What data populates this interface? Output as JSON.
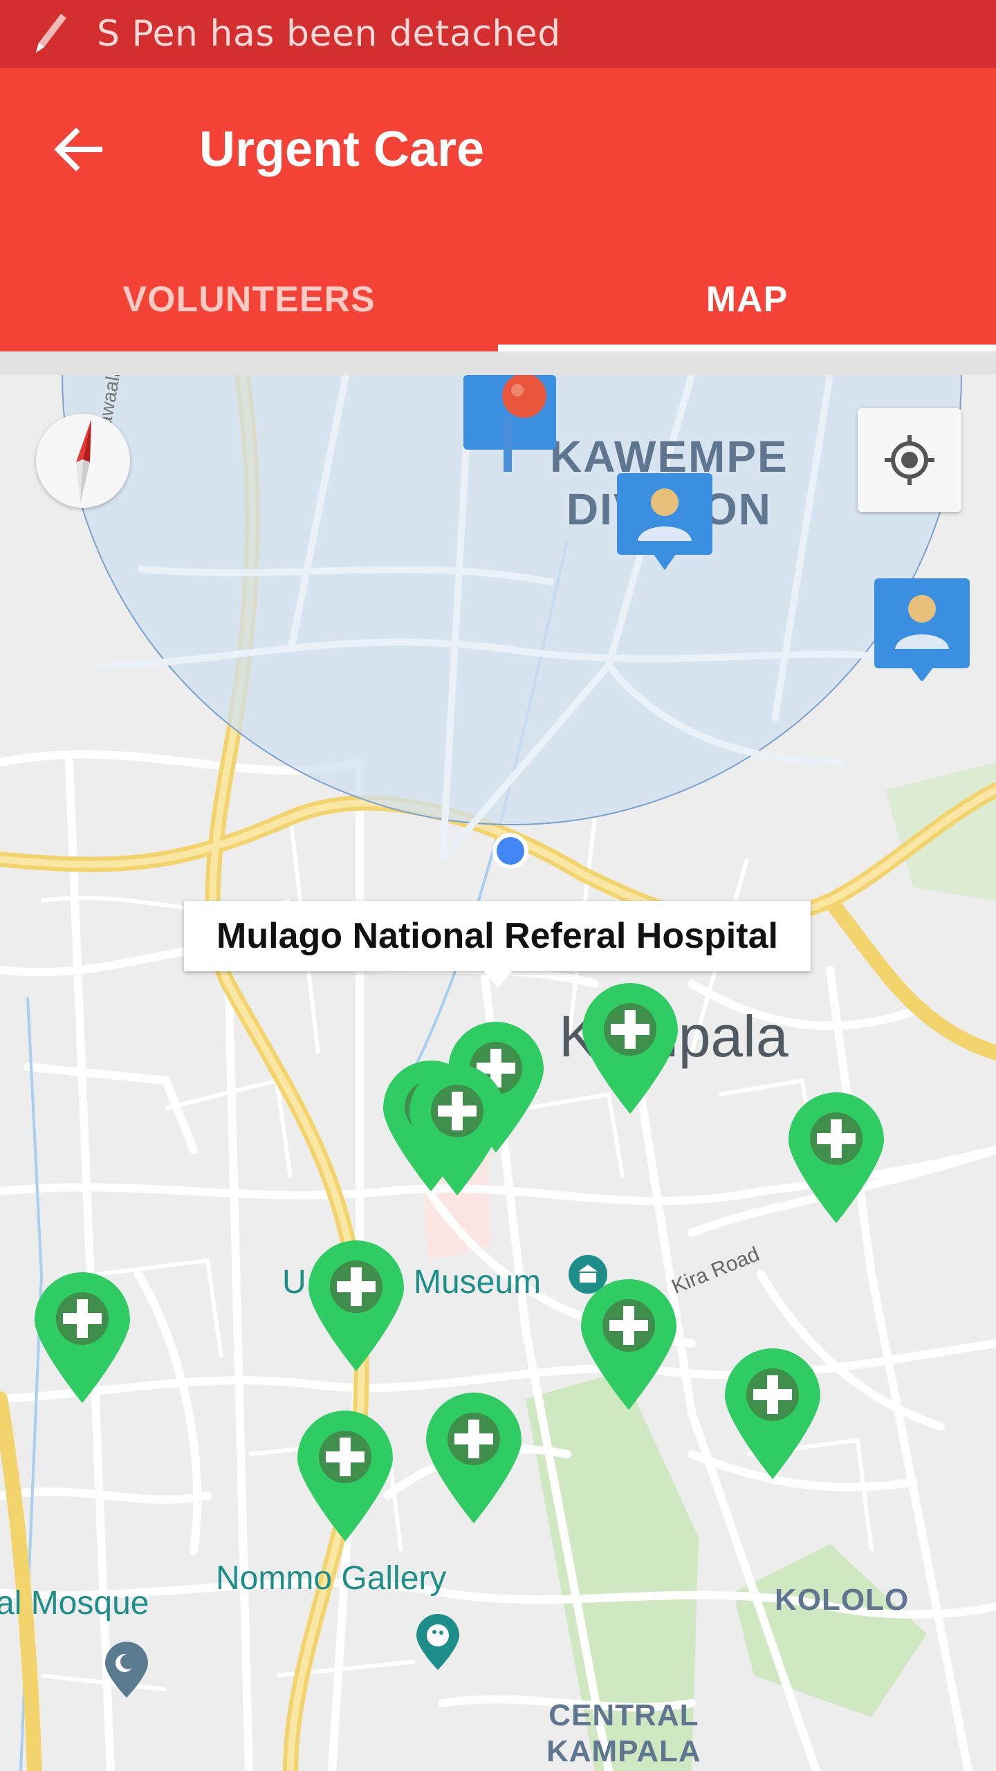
{
  "status_bar": {
    "notification": "S Pen has been detached",
    "icon": "pen-icon"
  },
  "app_bar": {
    "title": "Urgent Care",
    "back_icon": "arrow-back-icon",
    "color": "#f44336"
  },
  "tabs": [
    {
      "label": "VOLUNTEERS",
      "selected": false
    },
    {
      "label": "MAP",
      "selected": true
    }
  ],
  "map": {
    "info_window": "Mulago National Referal Hospital",
    "labels": {
      "kawempe_1": "KAWEMPE",
      "kawempe_2": "DIVISION",
      "kampala": "Kampala",
      "museum": "Museum",
      "museum_prefix": "U",
      "kira_road": "Kira Road",
      "kawaala_rd": "Kawaala Rd",
      "nommo_gallery": "Nommo Gallery",
      "mosque": "al Mosque",
      "kololo": "KOLOLO",
      "central_1": "CENTRAL",
      "central_2": "KAMPALA"
    },
    "hospital_marker_icon": "hospital-cross-icon",
    "volunteer_marker_icon": "person-icon",
    "hospital_marker_count": 12,
    "volunteer_marker_count": 3,
    "colors": {
      "hospital_marker": "#2ecc62",
      "volunteer_marker": "#3a8fe0",
      "current_location": "#4285f4",
      "radius_fill": "#cfdff0"
    }
  },
  "controls": {
    "compass_icon": "compass-icon",
    "my_location_icon": "my-location-icon"
  }
}
